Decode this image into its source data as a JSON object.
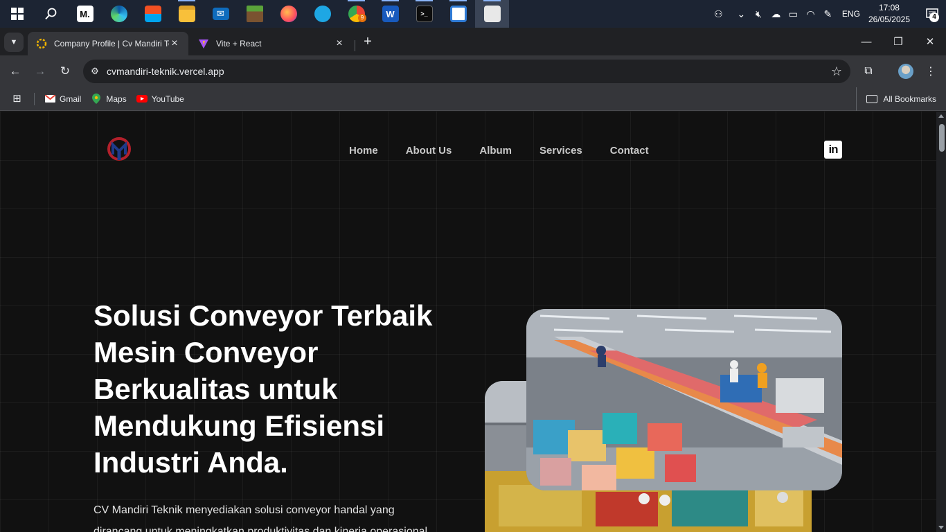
{
  "taskbar": {
    "apps": [
      {
        "name": "start-icon"
      },
      {
        "name": "search-icon"
      },
      {
        "name": "medium-icon",
        "glyph": "M."
      },
      {
        "name": "edge-icon"
      },
      {
        "name": "store-icon"
      },
      {
        "name": "file-explorer-icon"
      },
      {
        "name": "mail-icon"
      },
      {
        "name": "minecraft-icon"
      },
      {
        "name": "firefox-icon"
      },
      {
        "name": "app-icon"
      },
      {
        "name": "chrome-icon",
        "badge": "9"
      },
      {
        "name": "word-icon",
        "glyph": "W"
      },
      {
        "name": "terminal-icon"
      },
      {
        "name": "news-icon"
      },
      {
        "name": "snipping-icon"
      }
    ],
    "tray": {
      "language": "ENG",
      "time": "17:08",
      "date": "26/05/2025",
      "notification_count": "4"
    }
  },
  "browser": {
    "tabs": [
      {
        "title": "Company Profile | Cv Mandiri Te",
        "active": true
      },
      {
        "title": "Vite + React",
        "active": false
      }
    ],
    "url": "cvmandiri-teknik.vercel.app",
    "bookmarks": [
      {
        "label": "Gmail",
        "icon": "gmail-icon"
      },
      {
        "label": "Maps",
        "icon": "maps-icon"
      },
      {
        "label": "YouTube",
        "icon": "youtube-icon"
      }
    ],
    "all_bookmarks": "All Bookmarks"
  },
  "site": {
    "nav": [
      "Home",
      "About Us",
      "Album",
      "Services",
      "Contact"
    ],
    "linkedin": "in",
    "hero_title_lines": [
      "Solusi Conveyor Terbaik",
      "Mesin Conveyor",
      "Berkualitas untuk",
      "Mendukung Efisiensi",
      "Industri Anda."
    ],
    "hero_desc_lines": [
      "CV Mandiri Teknik menyediakan solusi conveyor handal yang",
      "dirancang untuk meningkatkan produktivitas dan kinerja operasional"
    ]
  },
  "colors": {
    "accent": "#8ab4f8",
    "page_bg": "#111111",
    "logo_red": "#b3202b",
    "logo_blue": "#1f3a8a"
  }
}
